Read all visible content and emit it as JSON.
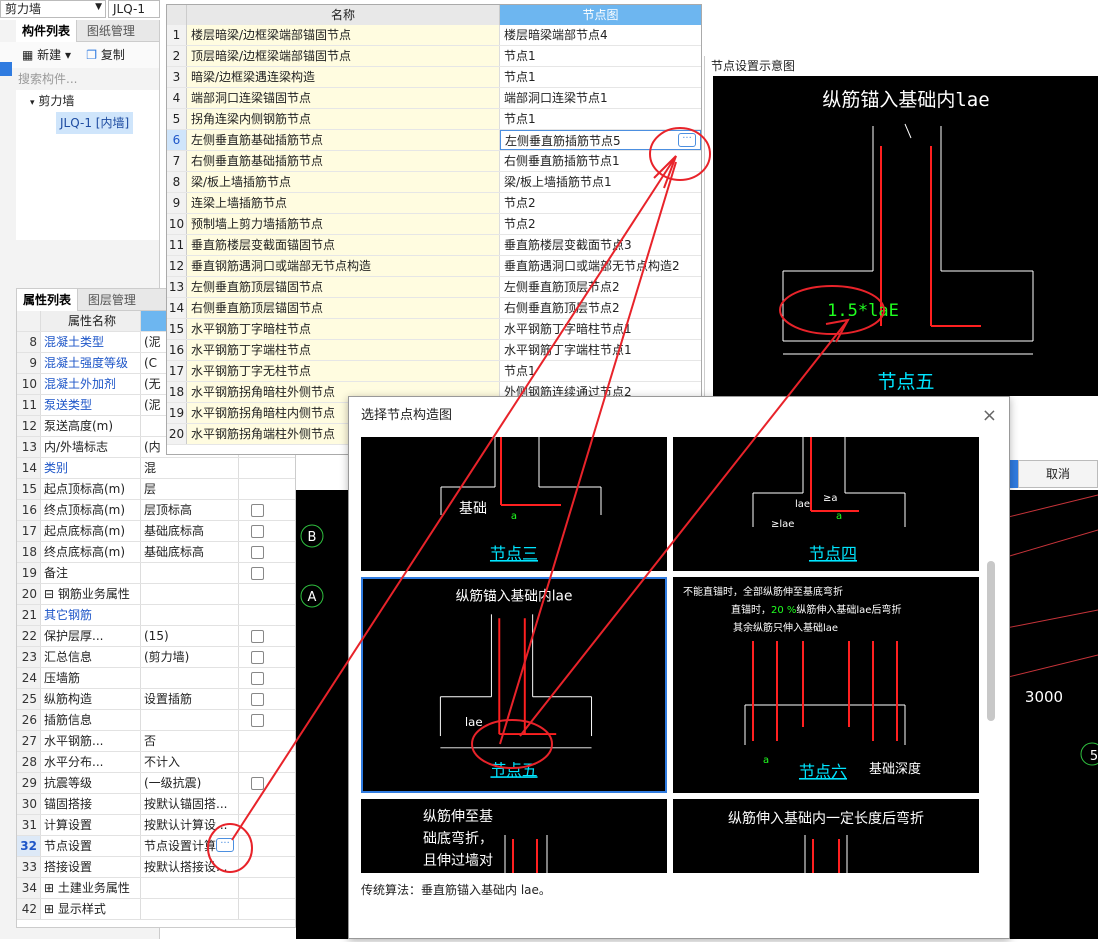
{
  "top": {
    "combo1": "剪力墙",
    "combo2": "JLQ-1"
  },
  "left": {
    "tab_components": "构件列表",
    "tab_drawings": "图纸管理",
    "new_label": "新建",
    "copy_label": "复制",
    "search_placeholder": "搜索构件...",
    "tree_root": "剪力墙",
    "tree_item": "JLQ-1 [内墙]"
  },
  "prop": {
    "tab_attr": "属性列表",
    "tab_layer": "图层管理",
    "col_name": "属性名称",
    "rows": [
      {
        "n": "8",
        "name": "混凝土类型",
        "val": "(泥",
        "blue": true,
        "chk": false
      },
      {
        "n": "9",
        "name": "混凝土强度等级",
        "val": "(C",
        "blue": true,
        "chk": false
      },
      {
        "n": "10",
        "name": "混凝土外加剂",
        "val": "(无",
        "blue": true,
        "chk": false
      },
      {
        "n": "11",
        "name": "泵送类型",
        "val": "(泥",
        "blue": true,
        "chk": false
      },
      {
        "n": "12",
        "name": "泵送高度(m)",
        "val": "",
        "blue": false,
        "chk": false
      },
      {
        "n": "13",
        "name": "内/外墙标志",
        "val": "(内",
        "blue": false,
        "chk": false
      },
      {
        "n": "14",
        "name": "类别",
        "val": "混",
        "blue": true,
        "chk": false
      },
      {
        "n": "15",
        "name": "起点顶标高(m)",
        "val": "层",
        "blue": false,
        "chk": false
      },
      {
        "n": "16",
        "name": "终点顶标高(m)",
        "val": "层顶标高",
        "blue": false,
        "chk": true
      },
      {
        "n": "17",
        "name": "起点底标高(m)",
        "val": "基础底标高",
        "blue": false,
        "chk": true
      },
      {
        "n": "18",
        "name": "终点底标高(m)",
        "val": "基础底标高",
        "blue": false,
        "chk": true
      },
      {
        "n": "19",
        "name": "备注",
        "val": "",
        "blue": false,
        "chk": true
      },
      {
        "n": "20",
        "name": "⊟ 钢筋业务属性",
        "val": "",
        "blue": false,
        "chk": false
      },
      {
        "n": "21",
        "name": "    其它钢筋",
        "val": "",
        "blue": true,
        "chk": false
      },
      {
        "n": "22",
        "name": "    保护层厚...",
        "val": "(15)",
        "blue": false,
        "chk": true
      },
      {
        "n": "23",
        "name": "    汇总信息",
        "val": "(剪力墙)",
        "blue": false,
        "chk": true
      },
      {
        "n": "24",
        "name": "    压墙筋",
        "val": "",
        "blue": false,
        "chk": true
      },
      {
        "n": "25",
        "name": "    纵筋构造",
        "val": "设置插筋",
        "blue": false,
        "chk": true
      },
      {
        "n": "26",
        "name": "    插筋信息",
        "val": "",
        "blue": false,
        "chk": true
      },
      {
        "n": "27",
        "name": "    水平钢筋...",
        "val": "否",
        "blue": false,
        "chk": false
      },
      {
        "n": "28",
        "name": "    水平分布...",
        "val": "不计入",
        "blue": false,
        "chk": false
      },
      {
        "n": "29",
        "name": "    抗震等级",
        "val": "(一级抗震)",
        "blue": false,
        "chk": true
      },
      {
        "n": "30",
        "name": "    锚固搭接",
        "val": "按默认锚固搭...",
        "blue": false,
        "chk": false
      },
      {
        "n": "31",
        "name": "    计算设置",
        "val": "按默认计算设...",
        "blue": false,
        "chk": false
      },
      {
        "n": "32",
        "name": "    节点设置",
        "val": "节点设置计算",
        "blue": false,
        "chk": false,
        "sel": true
      },
      {
        "n": "33",
        "name": "    搭接设置",
        "val": "按默认搭接设...",
        "blue": false,
        "chk": false
      },
      {
        "n": "34",
        "name": "⊞ 土建业务属性",
        "val": "",
        "blue": false,
        "chk": false
      },
      {
        "n": "42",
        "name": "⊞ 显示样式",
        "val": "",
        "blue": false,
        "chk": false
      }
    ]
  },
  "nodes": {
    "col_name": "名称",
    "col_node": "节点图",
    "rows": [
      {
        "n": "1",
        "name": "楼层暗梁/边框梁端部锚固节点",
        "val": "楼层暗梁端部节点4"
      },
      {
        "n": "2",
        "name": "顶层暗梁/边框梁端部锚固节点",
        "val": "节点1"
      },
      {
        "n": "3",
        "name": "暗梁/边框梁遇连梁构造",
        "val": "节点1"
      },
      {
        "n": "4",
        "name": "端部洞口连梁锚固节点",
        "val": "端部洞口连梁节点1"
      },
      {
        "n": "5",
        "name": "拐角连梁内侧钢筋节点",
        "val": "节点1"
      },
      {
        "n": "6",
        "name": "左侧垂直筋基础插筋节点",
        "val": "左侧垂直筋插筋节点5",
        "sel": true
      },
      {
        "n": "7",
        "name": "右侧垂直筋基础插筋节点",
        "val": "右侧垂直筋插筋节点1"
      },
      {
        "n": "8",
        "name": "梁/板上墙插筋节点",
        "val": "梁/板上墙插筋节点1"
      },
      {
        "n": "9",
        "name": "连梁上墙插筋节点",
        "val": "节点2"
      },
      {
        "n": "10",
        "name": "预制墙上剪力墙插筋节点",
        "val": "节点2"
      },
      {
        "n": "11",
        "name": "垂直筋楼层变截面锚固节点",
        "val": "垂直筋楼层变截面节点3"
      },
      {
        "n": "12",
        "name": "垂直钢筋遇洞口或端部无节点构造",
        "val": "垂直筋遇洞口或端部无节点构造2"
      },
      {
        "n": "13",
        "name": "左侧垂直筋顶层锚固节点",
        "val": "左侧垂直筋顶层节点2"
      },
      {
        "n": "14",
        "name": "右侧垂直筋顶层锚固节点",
        "val": "右侧垂直筋顶层节点2"
      },
      {
        "n": "15",
        "name": "水平钢筋丁字暗柱节点",
        "val": "水平钢筋丁字暗柱节点1"
      },
      {
        "n": "16",
        "name": "水平钢筋丁字端柱节点",
        "val": "水平钢筋丁字端柱节点1"
      },
      {
        "n": "17",
        "name": "水平钢筋丁字无柱节点",
        "val": "节点1"
      },
      {
        "n": "18",
        "name": "水平钢筋拐角暗柱外侧节点",
        "val": "外侧钢筋连续通过节点2"
      },
      {
        "n": "19",
        "name": "水平钢筋拐角暗柱内侧节点",
        "val": ""
      },
      {
        "n": "20",
        "name": "水平钢筋拐角端柱外侧节点",
        "val": ""
      }
    ]
  },
  "preview": {
    "title": "节点设置示意图",
    "heading": "纵筋锚入基础内lae",
    "dim": "1.5*laE",
    "caption": "节点五"
  },
  "dialog": {
    "title": "选择节点构造图",
    "close": "×",
    "tile3_label": "基础",
    "tile3_a": "a",
    "tile3_caption": "节点三",
    "tile4_lae": "lae",
    "tile4_ge": "≥a",
    "tile4_ge2": "≥lae",
    "tile4_a": "a",
    "tile4_caption": "节点四",
    "tile5_heading": "纵筋锚入基础内lae",
    "tile5_lae": "lae",
    "tile5_caption": "节点五",
    "tile6_l1": "不能直锚时，全部纵筋伸至基底弯折",
    "tile6_l2a": "直锚时，",
    "tile6_l2pct": "20 %",
    "tile6_l2b": "纵筋伸入基础lae后弯折",
    "tile6_l3": "其余纵筋只伸入基础lae",
    "tile6_a": "a",
    "tile6_caption": "节点六",
    "tile6_depth": "基础深度",
    "tile7_l1": "纵筋伸至基",
    "tile7_l2": "础底弯折，",
    "tile7_l3": "且伸过墙对",
    "tile8_l1": "纵筋伸入基础内一定长度后弯折",
    "footer": "传统算法：垂直筋锚入基础内 lae。"
  },
  "right": {
    "cancel": "取消",
    "axis_b": "B",
    "axis_a": "A",
    "dim_3000": "3000",
    "axis_5": "5"
  }
}
